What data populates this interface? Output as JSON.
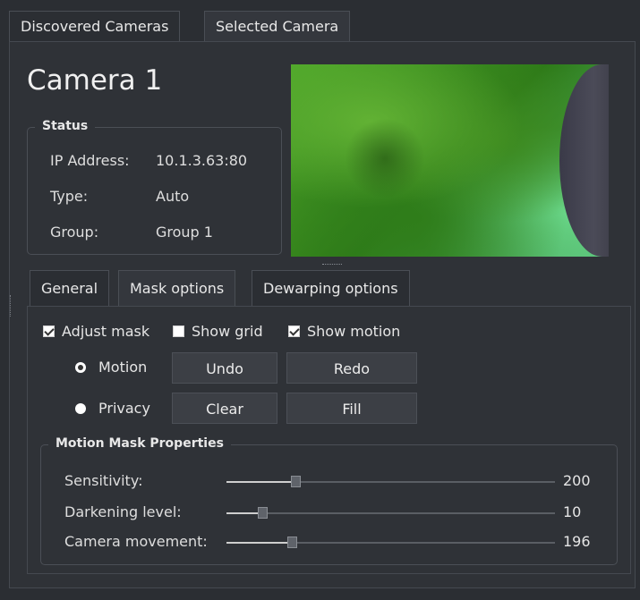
{
  "top_tabs": [
    "Discovered Cameras",
    "Selected Camera"
  ],
  "camera": {
    "title": "Camera 1"
  },
  "status": {
    "title": "Status",
    "ip_label": "IP Address:",
    "ip_value": "10.1.3.63:80",
    "type_label": "Type:",
    "type_value": "Auto",
    "group_label": "Group:",
    "group_value": "Group 1"
  },
  "inner_tabs": [
    "General",
    "Mask options",
    "Dewarping options"
  ],
  "mask": {
    "adjust_mask": {
      "label": "Adjust mask",
      "checked": true
    },
    "show_grid": {
      "label": "Show grid",
      "checked": false
    },
    "show_motion": {
      "label": "Show motion",
      "checked": true
    },
    "motion_radio": {
      "label": "Motion",
      "checked": true
    },
    "privacy_radio": {
      "label": "Privacy",
      "checked": false
    },
    "undo": "Undo",
    "redo": "Redo",
    "clear": "Clear",
    "fill": "Fill"
  },
  "properties": {
    "title": "Motion Mask Properties",
    "sensitivity": {
      "label": "Sensitivity:",
      "value": "200",
      "level": 0.21
    },
    "darkening": {
      "label": "Darkening level:",
      "value": "10",
      "level": 0.11
    },
    "movement": {
      "label": "Camera movement:",
      "value": "196",
      "level": 0.2
    }
  }
}
